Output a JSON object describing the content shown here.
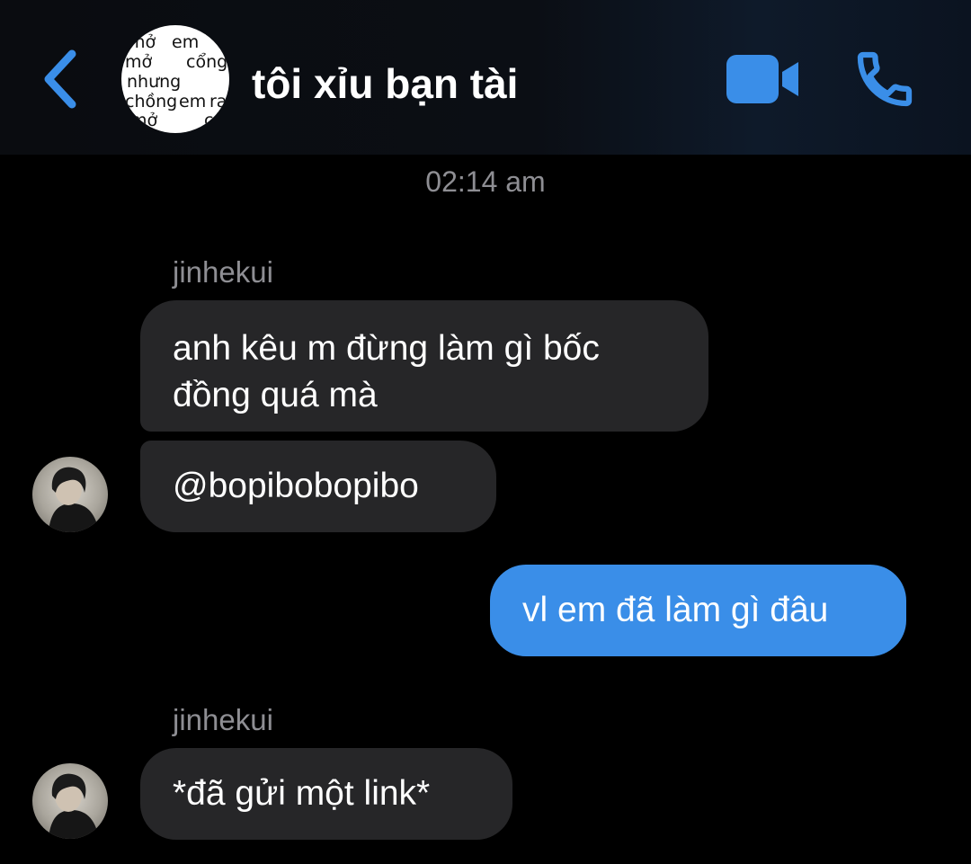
{
  "header": {
    "back_icon": "chevron-left-icon",
    "title": "tôi xỉu bạn tài",
    "avatar_words": [
      "mở",
      "em",
      "mở",
      "cổng",
      "nhưng",
      "chồng",
      "em",
      "ra",
      "mở",
      "cửa"
    ],
    "video_icon": "video-camera-icon",
    "call_icon": "phone-icon",
    "accent_color": "#3a8ee8"
  },
  "timestamp": "02:14 am",
  "messages": [
    {
      "sender": "jinhekui",
      "direction": "incoming",
      "lines": [
        "anh kêu m đừng làm gì bốc",
        "đồng quá mà"
      ]
    },
    {
      "sender": "jinhekui",
      "direction": "incoming",
      "lines": [
        "@bopibobopibo"
      ]
    },
    {
      "sender": "me",
      "direction": "outgoing",
      "lines": [
        "vl em đã làm gì đâu"
      ]
    },
    {
      "sender": "jinhekui",
      "direction": "incoming",
      "lines": [
        "*đã gửi một link*"
      ]
    }
  ],
  "colors": {
    "incoming_bubble": "#262628",
    "outgoing_bubble": "#3a8ee8",
    "meta_text": "#8e8e93"
  }
}
